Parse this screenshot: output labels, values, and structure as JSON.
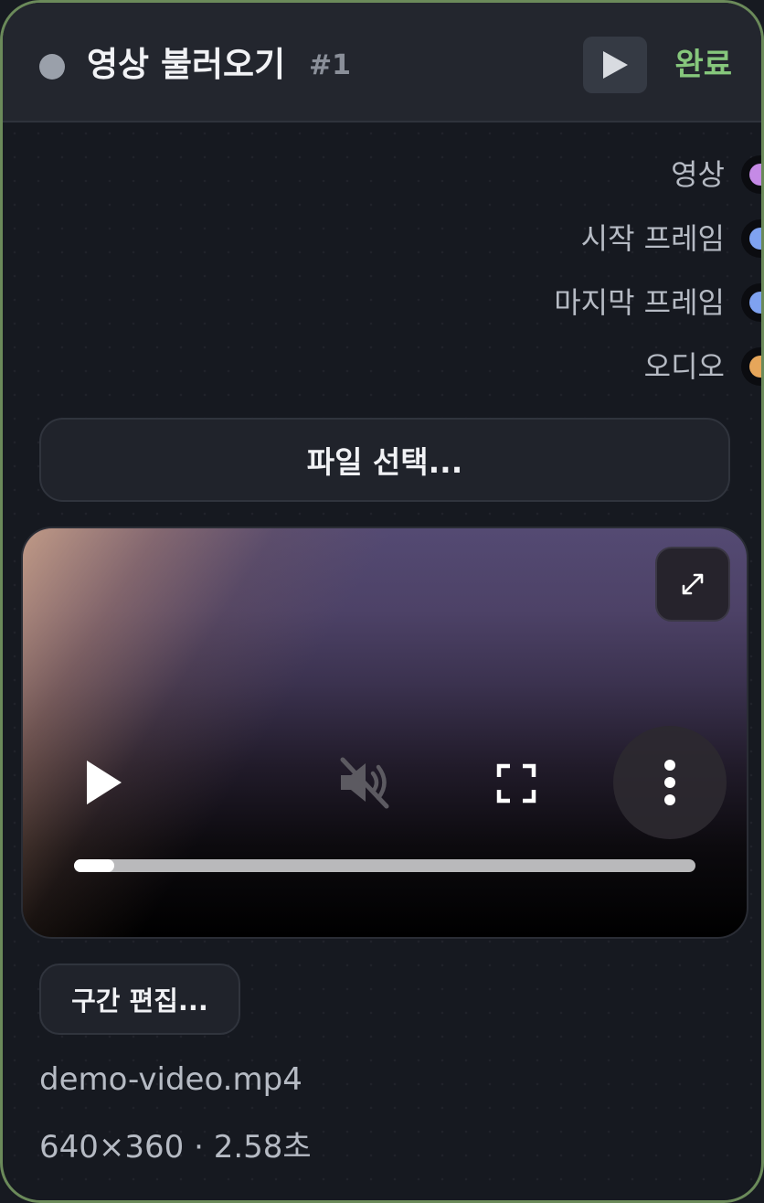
{
  "node": {
    "title": "영상 불러오기",
    "id_label": "#1",
    "status": "완료",
    "run_icon": "play-icon"
  },
  "outputs": [
    {
      "label": "영상",
      "color": "#c58ae6"
    },
    {
      "label": "시작 프레임",
      "color": "#7fa2f0"
    },
    {
      "label": "마지막 프레임",
      "color": "#7fa2f0"
    },
    {
      "label": "오디오",
      "color": "#e6a65a"
    }
  ],
  "file_button": {
    "label": "파일 선택..."
  },
  "player": {
    "expand_icon": "expand-icon",
    "play_icon": "play-icon",
    "mute_icon": "volume-muted-icon",
    "fullscreen_icon": "fullscreen-icon",
    "more_icon": "more-vertical-icon",
    "progress": 0.065
  },
  "trim_button": {
    "label": "구간 편집..."
  },
  "file": {
    "name": "demo-video.mp4",
    "meta": "640×360 · 2.58초"
  }
}
